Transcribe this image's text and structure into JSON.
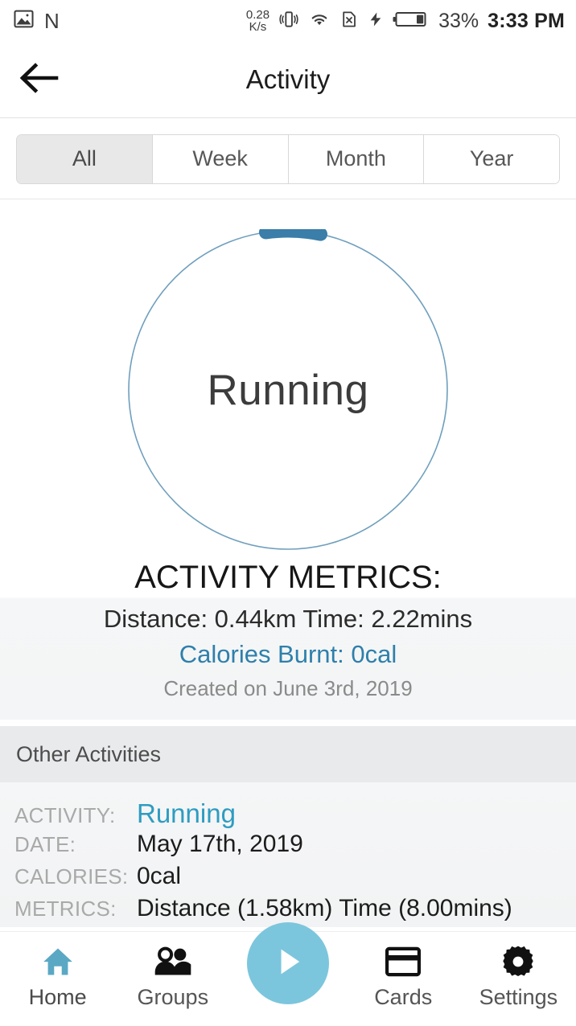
{
  "status_bar": {
    "left_icons": [
      "image-icon",
      "n-indicator"
    ],
    "n_label": "N",
    "net_speed_value": "0.28",
    "net_speed_unit": "K/s",
    "right_icons": [
      "vibrate-icon",
      "wifi-icon",
      "no-sim-icon",
      "charging-bolt-icon",
      "battery-icon"
    ],
    "battery_percent": "33%",
    "clock": "3:33 PM"
  },
  "appbar": {
    "back_icon": "arrow-left-icon",
    "title": "Activity"
  },
  "filter_tabs": {
    "items": [
      {
        "label": "All",
        "active": true
      },
      {
        "label": "Week",
        "active": false
      },
      {
        "label": "Month",
        "active": false
      },
      {
        "label": "Year",
        "active": false
      }
    ]
  },
  "ring": {
    "center_label": "Running",
    "track_color": "#6f9fbd",
    "progress_color": "#3a7ea9",
    "progress_fraction": 0.055,
    "start_angle_deg": -8
  },
  "metrics": {
    "title": "ACTIVITY METRICS:",
    "summary_line": "Distance: 0.44km  Time: 2.22mins",
    "distance": "0.44km",
    "time": "2.22mins",
    "calories_line": "Calories Burnt: 0cal",
    "created_line": "Created on June 3rd, 2019",
    "accent_color": "#2e80ab"
  },
  "other_activities": {
    "header": "Other Activities",
    "rows": [
      {
        "label": "ACTIVITY:",
        "value": "Running",
        "accent": true
      },
      {
        "label": "DATE:",
        "value": "May 17th, 2019",
        "accent": false
      },
      {
        "label": "CALORIES:",
        "value": "0cal",
        "accent": false
      },
      {
        "label": "METRICS:",
        "value": "Distance (1.58km)  Time (8.00mins)",
        "accent": false
      }
    ]
  },
  "bottom_nav": {
    "items": [
      {
        "label": "Home",
        "icon": "home-icon",
        "active": true
      },
      {
        "label": "Groups",
        "icon": "people-icon",
        "active": false
      },
      {
        "label": "Cards",
        "icon": "card-icon",
        "active": false
      },
      {
        "label": "Settings",
        "icon": "gear-icon",
        "active": false
      }
    ],
    "fab_icon": "play-icon",
    "fab_color": "#7cc6dd",
    "active_color": "#5ba8c4"
  }
}
